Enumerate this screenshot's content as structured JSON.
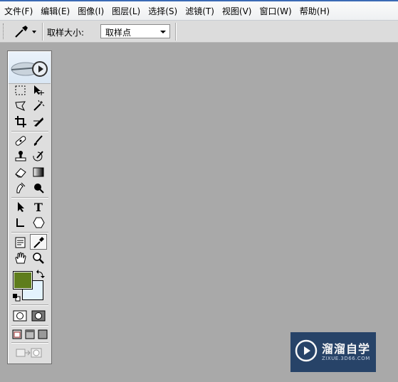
{
  "menubar": {
    "items": [
      "文件(F)",
      "编辑(E)",
      "图像(I)",
      "图层(L)",
      "选择(S)",
      "滤镜(T)",
      "视图(V)",
      "窗口(W)",
      "帮助(H)"
    ]
  },
  "options": {
    "sample_size_label": "取样大小:",
    "sample_size_value": "取样点"
  },
  "toolbox": {
    "foreground_color": "#5f7d1c",
    "background_color": "#e3f3fd",
    "active_tool": "eyedropper"
  },
  "watermark": {
    "title": "溜溜自学",
    "subtitle": "ZIXUE.3D66.COM"
  }
}
